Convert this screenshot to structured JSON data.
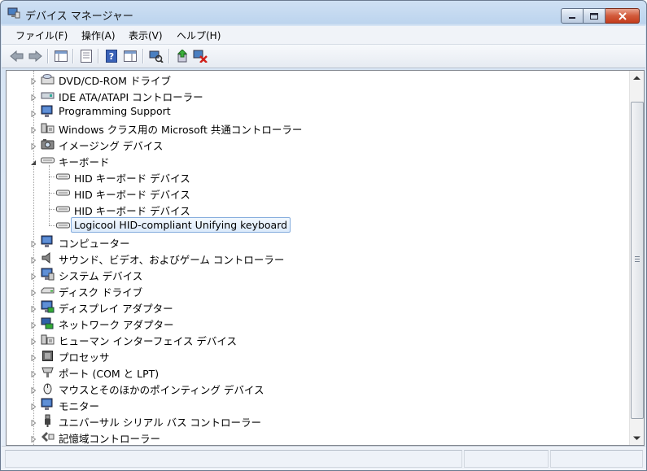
{
  "window": {
    "title": "デバイス マネージャー",
    "colors": {
      "titlebar": "#bcd4ee",
      "selection_border": "#84acdd",
      "close_button": "#c43c1c"
    }
  },
  "menu": [
    {
      "label": "ファイル(F)"
    },
    {
      "label": "操作(A)"
    },
    {
      "label": "表示(V)"
    },
    {
      "label": "ヘルプ(H)"
    }
  ],
  "toolbar": [
    "back-arrow-icon",
    "forward-arrow-icon",
    "show-hide-console-tree-icon",
    "properties-icon",
    "help-icon",
    "action-pane-icon",
    "scan-hardware-icon",
    "update-driver-icon",
    "uninstall-device-icon"
  ],
  "tree": [
    {
      "label": "DVD/CD-ROM ドライブ",
      "icon": "dvd-drive-icon",
      "level": 0,
      "expanded": false
    },
    {
      "label": "IDE ATA/ATAPI コントローラー",
      "icon": "ide-controller-icon",
      "level": 0,
      "expanded": false
    },
    {
      "label": "Programming Support",
      "icon": "monitor-icon",
      "level": 0,
      "expanded": false
    },
    {
      "label": "Windows クラス用の Microsoft 共通コントローラー",
      "icon": "usb-controller-icon",
      "level": 0,
      "expanded": false
    },
    {
      "label": "イメージング デバイス",
      "icon": "camera-icon",
      "level": 0,
      "expanded": false
    },
    {
      "label": "キーボード",
      "icon": "keyboard-icon",
      "level": 0,
      "expanded": true
    },
    {
      "label": "HID キーボード デバイス",
      "icon": "keyboard-icon",
      "level": 1
    },
    {
      "label": "HID キーボード デバイス",
      "icon": "keyboard-icon",
      "level": 1
    },
    {
      "label": "HID キーボード デバイス",
      "icon": "keyboard-icon",
      "level": 1
    },
    {
      "label": "Logicool HID-compliant Unifying keyboard",
      "icon": "keyboard-icon",
      "level": 1,
      "selected": true
    },
    {
      "label": "コンピューター",
      "icon": "computer-icon",
      "level": 0,
      "expanded": false
    },
    {
      "label": "サウンド、ビデオ、およびゲーム コントローラー",
      "icon": "speaker-icon",
      "level": 0,
      "expanded": false
    },
    {
      "label": "システム デバイス",
      "icon": "system-device-icon",
      "level": 0,
      "expanded": false
    },
    {
      "label": "ディスク ドライブ",
      "icon": "disk-drive-icon",
      "level": 0,
      "expanded": false
    },
    {
      "label": "ディスプレイ アダプター",
      "icon": "display-adapter-icon",
      "level": 0,
      "expanded": false
    },
    {
      "label": "ネットワーク アダプター",
      "icon": "network-adapter-icon",
      "level": 0,
      "expanded": false
    },
    {
      "label": "ヒューマン インターフェイス デバイス",
      "icon": "hid-icon",
      "level": 0,
      "expanded": false
    },
    {
      "label": "プロセッサ",
      "icon": "processor-icon",
      "level": 0,
      "expanded": false
    },
    {
      "label": "ポート (COM と LPT)",
      "icon": "port-icon",
      "level": 0,
      "expanded": false
    },
    {
      "label": "マウスとそのほかのポインティング デバイス",
      "icon": "mouse-icon",
      "level": 0,
      "expanded": false
    },
    {
      "label": "モニター",
      "icon": "monitor-icon",
      "level": 0,
      "expanded": false
    },
    {
      "label": "ユニバーサル シリアル バス コントローラー",
      "icon": "usb-plug-icon",
      "level": 0,
      "expanded": false
    },
    {
      "label": "記憶域コントローラー",
      "icon": "storage-controller-icon",
      "level": 0,
      "expanded": false
    }
  ]
}
